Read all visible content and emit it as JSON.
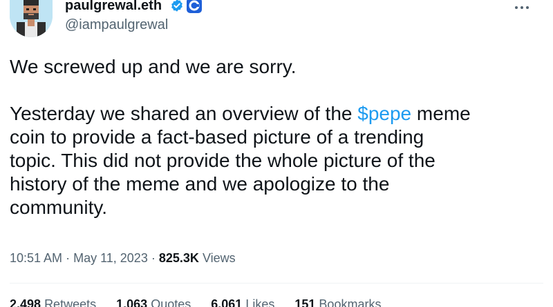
{
  "author": {
    "display_name": "paulgrewal.eth",
    "handle": "@iampaulgrewal",
    "avatar_icon": "pixel-art-avatar",
    "verified_icon": "verified-badge-icon",
    "affiliate_icon": "affiliate-badge-icon",
    "verified_color": "#1d9bf0",
    "affiliate_color": "#1e5fd8"
  },
  "tweet": {
    "line1": "We screwed up and we are sorry.",
    "para2_prefix": "Yesterday we shared an overview of the ",
    "cashtag": "$pepe",
    "para2_line1_suffix": " meme",
    "para2_line2": "coin to provide a fact-based picture of a trending",
    "para2_line3": "topic. This did not provide the whole picture of the",
    "para2_line4": "history of the meme and we apologize to the",
    "para2_line5": "community."
  },
  "meta": {
    "time": "10:51 AM",
    "separator": "·",
    "date": "May 11, 2023",
    "views_count": "825.3K",
    "views_label": "Views"
  },
  "stats": [
    {
      "count": "2,498",
      "label": "Retweets"
    },
    {
      "count": "1,063",
      "label": "Quotes"
    },
    {
      "count": "6,061",
      "label": "Likes"
    },
    {
      "count": "151",
      "label": "Bookmarks"
    }
  ],
  "colors": {
    "text": "#0f1419",
    "secondary": "#536471",
    "link": "#1d9bf0"
  }
}
